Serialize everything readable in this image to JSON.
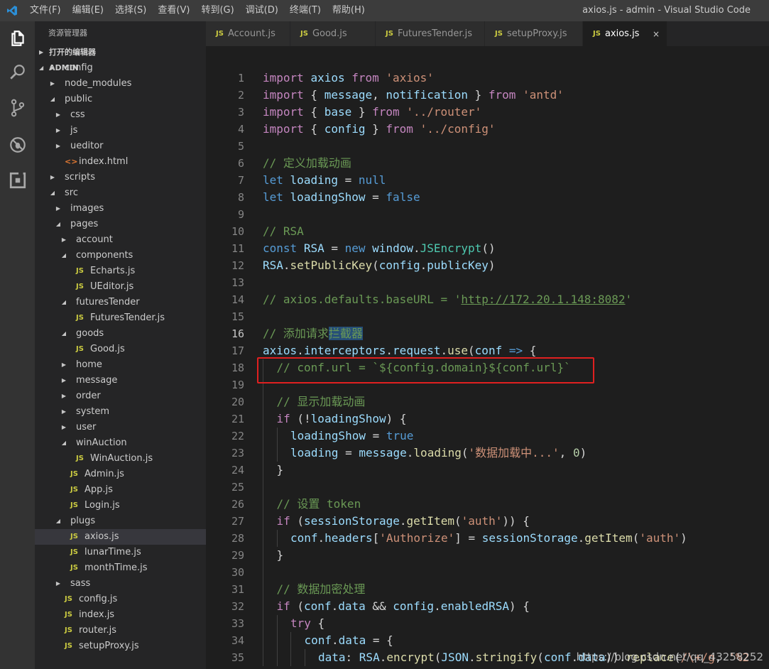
{
  "titlebar": {
    "menu": [
      "文件(F)",
      "编辑(E)",
      "选择(S)",
      "查看(V)",
      "转到(G)",
      "调试(D)",
      "终端(T)",
      "帮助(H)"
    ],
    "window_title": "axios.js - admin - Visual Studio Code"
  },
  "activitybar": {
    "icons": [
      "files-icon",
      "search-icon",
      "source-control-icon",
      "debug-icon",
      "extensions-icon"
    ]
  },
  "sidebar": {
    "title": "资源管理器",
    "open_editors": "打开的编辑器",
    "root": "ADMIN",
    "tree": [
      {
        "label": "config",
        "type": "folder",
        "depth": 1,
        "open": false
      },
      {
        "label": "node_modules",
        "type": "folder",
        "depth": 1,
        "open": false
      },
      {
        "label": "public",
        "type": "folder",
        "depth": 1,
        "open": true
      },
      {
        "label": "css",
        "type": "folder",
        "depth": 2,
        "open": false
      },
      {
        "label": "js",
        "type": "folder",
        "depth": 2,
        "open": false
      },
      {
        "label": "ueditor",
        "type": "folder",
        "depth": 2,
        "open": false
      },
      {
        "label": "index.html",
        "type": "html",
        "depth": 2
      },
      {
        "label": "scripts",
        "type": "folder",
        "depth": 1,
        "open": false
      },
      {
        "label": "src",
        "type": "folder",
        "depth": 1,
        "open": true
      },
      {
        "label": "images",
        "type": "folder",
        "depth": 2,
        "open": false
      },
      {
        "label": "pages",
        "type": "folder",
        "depth": 2,
        "open": true
      },
      {
        "label": "account",
        "type": "folder",
        "depth": 3,
        "open": false
      },
      {
        "label": "components",
        "type": "folder",
        "depth": 3,
        "open": true
      },
      {
        "label": "Echarts.js",
        "type": "js",
        "depth": 4
      },
      {
        "label": "UEditor.js",
        "type": "js",
        "depth": 4
      },
      {
        "label": "futuresTender",
        "type": "folder",
        "depth": 3,
        "open": true
      },
      {
        "label": "FuturesTender.js",
        "type": "js",
        "depth": 4
      },
      {
        "label": "goods",
        "type": "folder",
        "depth": 3,
        "open": true
      },
      {
        "label": "Good.js",
        "type": "js",
        "depth": 4
      },
      {
        "label": "home",
        "type": "folder",
        "depth": 3,
        "open": false
      },
      {
        "label": "message",
        "type": "folder",
        "depth": 3,
        "open": false
      },
      {
        "label": "order",
        "type": "folder",
        "depth": 3,
        "open": false
      },
      {
        "label": "system",
        "type": "folder",
        "depth": 3,
        "open": false
      },
      {
        "label": "user",
        "type": "folder",
        "depth": 3,
        "open": false
      },
      {
        "label": "winAuction",
        "type": "folder",
        "depth": 3,
        "open": true
      },
      {
        "label": "WinAuction.js",
        "type": "js",
        "depth": 4
      },
      {
        "label": "Admin.js",
        "type": "js",
        "depth": 3
      },
      {
        "label": "App.js",
        "type": "js",
        "depth": 3
      },
      {
        "label": "Login.js",
        "type": "js",
        "depth": 3
      },
      {
        "label": "plugs",
        "type": "folder",
        "depth": 2,
        "open": true
      },
      {
        "label": "axios.js",
        "type": "js",
        "depth": 3,
        "selected": true
      },
      {
        "label": "lunarTime.js",
        "type": "js",
        "depth": 3
      },
      {
        "label": "monthTime.js",
        "type": "js",
        "depth": 3
      },
      {
        "label": "sass",
        "type": "folder",
        "depth": 2,
        "open": false
      },
      {
        "label": "config.js",
        "type": "js",
        "depth": 2
      },
      {
        "label": "index.js",
        "type": "js",
        "depth": 2
      },
      {
        "label": "router.js",
        "type": "js",
        "depth": 2
      },
      {
        "label": "setupProxy.js",
        "type": "js",
        "depth": 2
      }
    ]
  },
  "tabs": [
    {
      "label": "Account.js",
      "active": false,
      "width": 119
    },
    {
      "label": "Good.js",
      "active": false,
      "width": 120
    },
    {
      "label": "FuturesTender.js",
      "active": false,
      "width": 154
    },
    {
      "label": "setupProxy.js",
      "active": false,
      "width": 138
    },
    {
      "label": "axios.js",
      "active": true,
      "width": 119
    }
  ],
  "tab_icon_text": "JS",
  "close_glyph": "×",
  "editor": {
    "current_line": 16,
    "lines": [
      {
        "n": "1",
        "indent": 0,
        "t": [
          [
            "import",
            "kc"
          ],
          [
            " ",
            "op"
          ],
          [
            "axios",
            "id"
          ],
          [
            " ",
            "op"
          ],
          [
            "from",
            "kc"
          ],
          [
            " ",
            "op"
          ],
          [
            "'axios'",
            "str"
          ]
        ]
      },
      {
        "n": "2",
        "indent": 0,
        "t": [
          [
            "import",
            "kc"
          ],
          [
            " { ",
            "op"
          ],
          [
            "message",
            "id"
          ],
          [
            ", ",
            "op"
          ],
          [
            "notification",
            "id"
          ],
          [
            " } ",
            "op"
          ],
          [
            "from",
            "kc"
          ],
          [
            " ",
            "op"
          ],
          [
            "'antd'",
            "str"
          ]
        ]
      },
      {
        "n": "3",
        "indent": 0,
        "t": [
          [
            "import",
            "kc"
          ],
          [
            " { ",
            "op"
          ],
          [
            "base",
            "id"
          ],
          [
            " } ",
            "op"
          ],
          [
            "from",
            "kc"
          ],
          [
            " ",
            "op"
          ],
          [
            "'../router'",
            "str"
          ]
        ]
      },
      {
        "n": "4",
        "indent": 0,
        "t": [
          [
            "import",
            "kc"
          ],
          [
            " { ",
            "op"
          ],
          [
            "config",
            "id"
          ],
          [
            " } ",
            "op"
          ],
          [
            "from",
            "kc"
          ],
          [
            " ",
            "op"
          ],
          [
            "'../config'",
            "str"
          ]
        ]
      },
      {
        "n": "5",
        "indent": 0,
        "t": []
      },
      {
        "n": "6",
        "indent": 0,
        "t": [
          [
            "// 定义加载动画",
            "cm"
          ]
        ]
      },
      {
        "n": "7",
        "indent": 0,
        "t": [
          [
            "let",
            "kw"
          ],
          [
            " ",
            "op"
          ],
          [
            "loading",
            "id"
          ],
          [
            " = ",
            "op"
          ],
          [
            "null",
            "kw"
          ]
        ]
      },
      {
        "n": "8",
        "indent": 0,
        "t": [
          [
            "let",
            "kw"
          ],
          [
            " ",
            "op"
          ],
          [
            "loadingShow",
            "id"
          ],
          [
            " = ",
            "op"
          ],
          [
            "false",
            "kw"
          ]
        ]
      },
      {
        "n": "9",
        "indent": 0,
        "t": []
      },
      {
        "n": "10",
        "indent": 0,
        "t": [
          [
            "// RSA",
            "cm"
          ]
        ]
      },
      {
        "n": "11",
        "indent": 0,
        "t": [
          [
            "const",
            "kw"
          ],
          [
            " ",
            "op"
          ],
          [
            "RSA",
            "id"
          ],
          [
            " = ",
            "op"
          ],
          [
            "new",
            "kw"
          ],
          [
            " ",
            "op"
          ],
          [
            "window",
            "id"
          ],
          [
            ".",
            "op"
          ],
          [
            "JSEncrypt",
            "cls"
          ],
          [
            "()",
            "op"
          ]
        ]
      },
      {
        "n": "12",
        "indent": 0,
        "t": [
          [
            "RSA",
            "id"
          ],
          [
            ".",
            "op"
          ],
          [
            "setPublicKey",
            "fn"
          ],
          [
            "(",
            "op"
          ],
          [
            "config",
            "id"
          ],
          [
            ".",
            "op"
          ],
          [
            "publicKey",
            "id"
          ],
          [
            ")",
            "op"
          ]
        ]
      },
      {
        "n": "13",
        "indent": 0,
        "t": []
      },
      {
        "n": "14",
        "indent": 0,
        "t": [
          [
            "// axios.defaults.baseURL = '",
            "cm"
          ],
          [
            "http://172.20.1.148:8082",
            "cm url"
          ],
          [
            "'",
            "cm"
          ]
        ]
      },
      {
        "n": "15",
        "indent": 0,
        "t": []
      },
      {
        "n": "16",
        "indent": 0,
        "t": [
          [
            "// 添加请求",
            "cm"
          ],
          [
            "拦截器",
            "cm hl"
          ]
        ]
      },
      {
        "n": "17",
        "indent": 0,
        "t": [
          [
            "axios",
            "id"
          ],
          [
            ".",
            "op"
          ],
          [
            "interceptors",
            "id"
          ],
          [
            ".",
            "op"
          ],
          [
            "request",
            "id"
          ],
          [
            ".",
            "op"
          ],
          [
            "use",
            "fn"
          ],
          [
            "(",
            "op"
          ],
          [
            "conf",
            "id"
          ],
          [
            " ",
            "op"
          ],
          [
            "=>",
            "kw"
          ],
          [
            " {",
            "op"
          ]
        ]
      },
      {
        "n": "18",
        "indent": 1,
        "t": [
          [
            "// conf.url = `${config.domain}${conf.url}`",
            "cm"
          ]
        ]
      },
      {
        "n": "19",
        "indent": 1,
        "t": []
      },
      {
        "n": "20",
        "indent": 1,
        "t": [
          [
            "// 显示加载动画",
            "cm"
          ]
        ]
      },
      {
        "n": "21",
        "indent": 1,
        "t": [
          [
            "if",
            "kc"
          ],
          [
            " (!",
            "op"
          ],
          [
            "loadingShow",
            "id"
          ],
          [
            ") {",
            "op"
          ]
        ]
      },
      {
        "n": "22",
        "indent": 2,
        "t": [
          [
            "loadingShow",
            "id"
          ],
          [
            " = ",
            "op"
          ],
          [
            "true",
            "kw"
          ]
        ]
      },
      {
        "n": "23",
        "indent": 2,
        "t": [
          [
            "loading",
            "id"
          ],
          [
            " = ",
            "op"
          ],
          [
            "message",
            "id"
          ],
          [
            ".",
            "op"
          ],
          [
            "loading",
            "fn"
          ],
          [
            "(",
            "op"
          ],
          [
            "'数据加载中...'",
            "str"
          ],
          [
            ", ",
            "op"
          ],
          [
            "0",
            "num"
          ],
          [
            ")",
            "op"
          ]
        ]
      },
      {
        "n": "24",
        "indent": 1,
        "t": [
          [
            "}",
            "op"
          ]
        ]
      },
      {
        "n": "25",
        "indent": 1,
        "t": []
      },
      {
        "n": "26",
        "indent": 1,
        "t": [
          [
            "// 设置 token",
            "cm"
          ]
        ]
      },
      {
        "n": "27",
        "indent": 1,
        "t": [
          [
            "if",
            "kc"
          ],
          [
            " (",
            "op"
          ],
          [
            "sessionStorage",
            "id"
          ],
          [
            ".",
            "op"
          ],
          [
            "getItem",
            "fn"
          ],
          [
            "(",
            "op"
          ],
          [
            "'auth'",
            "str"
          ],
          [
            ")) {",
            "op"
          ]
        ]
      },
      {
        "n": "28",
        "indent": 2,
        "t": [
          [
            "conf",
            "id"
          ],
          [
            ".",
            "op"
          ],
          [
            "headers",
            "id"
          ],
          [
            "[",
            "op"
          ],
          [
            "'Authorize'",
            "str"
          ],
          [
            "] = ",
            "op"
          ],
          [
            "sessionStorage",
            "id"
          ],
          [
            ".",
            "op"
          ],
          [
            "getItem",
            "fn"
          ],
          [
            "(",
            "op"
          ],
          [
            "'auth'",
            "str"
          ],
          [
            ")",
            "op"
          ]
        ]
      },
      {
        "n": "29",
        "indent": 1,
        "t": [
          [
            "}",
            "op"
          ]
        ]
      },
      {
        "n": "30",
        "indent": 1,
        "t": []
      },
      {
        "n": "31",
        "indent": 1,
        "t": [
          [
            "// 数据加密处理",
            "cm"
          ]
        ]
      },
      {
        "n": "32",
        "indent": 1,
        "t": [
          [
            "if",
            "kc"
          ],
          [
            " (",
            "op"
          ],
          [
            "conf",
            "id"
          ],
          [
            ".",
            "op"
          ],
          [
            "data",
            "id"
          ],
          [
            " && ",
            "op"
          ],
          [
            "config",
            "id"
          ],
          [
            ".",
            "op"
          ],
          [
            "enabledRSA",
            "id"
          ],
          [
            ") {",
            "op"
          ]
        ]
      },
      {
        "n": "33",
        "indent": 2,
        "t": [
          [
            "try",
            "kc"
          ],
          [
            " {",
            "op"
          ]
        ]
      },
      {
        "n": "34",
        "indent": 3,
        "t": [
          [
            "conf",
            "id"
          ],
          [
            ".",
            "op"
          ],
          [
            "data",
            "id"
          ],
          [
            " = {",
            "op"
          ]
        ]
      },
      {
        "n": "35",
        "indent": 4,
        "t": [
          [
            "data",
            "id"
          ],
          [
            ": ",
            "op"
          ],
          [
            "RSA",
            "id"
          ],
          [
            ".",
            "op"
          ],
          [
            "encrypt",
            "fn"
          ],
          [
            "(",
            "op"
          ],
          [
            "JSON",
            "id"
          ],
          [
            ".",
            "op"
          ],
          [
            "stringify",
            "fn"
          ],
          [
            "(",
            "op"
          ],
          [
            "conf",
            "id"
          ],
          [
            ".",
            "op"
          ],
          [
            "data",
            "id"
          ],
          [
            ")).",
            "op"
          ],
          [
            "replace",
            "fn"
          ],
          [
            "(",
            "op"
          ],
          [
            "/\\+/g",
            "str"
          ],
          [
            ", ",
            "op"
          ],
          [
            "'%2",
            "str"
          ]
        ]
      }
    ]
  },
  "watermark": "https://blog.csdn.net/qq_43258252"
}
